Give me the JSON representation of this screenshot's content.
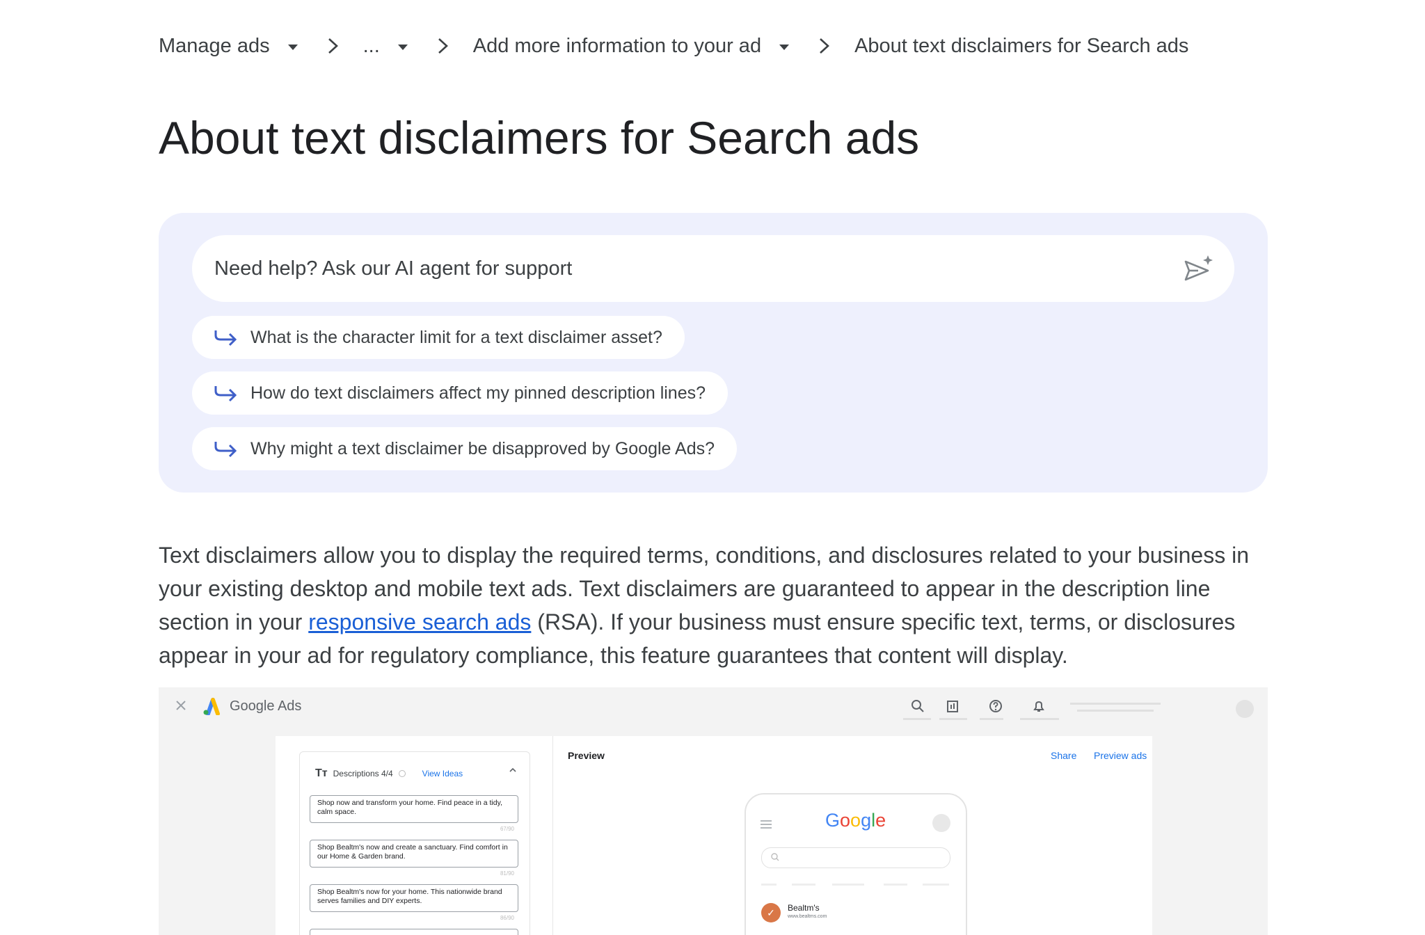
{
  "breadcrumb": {
    "items": [
      {
        "label": "Manage ads",
        "dropdown": true
      },
      {
        "label": "...",
        "dropdown": true
      },
      {
        "label": "Add more information to your ad",
        "dropdown": true
      },
      {
        "label": "About text disclaimers for Search ads",
        "dropdown": false
      }
    ]
  },
  "page_title": "About text disclaimers for Search ads",
  "ai_support": {
    "placeholder": "Need help? Ask our AI agent for support",
    "suggestions": [
      "What is the character limit for a text disclaimer asset?",
      "How do text disclaimers affect my pinned description lines?",
      "Why might a text disclaimer be disapproved by Google Ads?"
    ]
  },
  "body": {
    "part1": "Text disclaimers allow you to display the required terms, conditions, and disclosures related to your business in your existing desktop and mobile text ads. Text disclaimers are guaranteed to appear in the description line section in your ",
    "link": "responsive search ads",
    "part2": " (RSA). If your business must ensure specific text, terms, or disclosures appear in your ad for regulatory compliance, this feature guarantees that content will display."
  },
  "screenshot": {
    "app_name": "Google Ads",
    "descriptions_header": "Descriptions 4/4",
    "view_ideas": "View Ideas",
    "descriptions": [
      {
        "text": "Shop now and transform your home. Find peace in a tidy, calm space.",
        "count": "67/90"
      },
      {
        "text": "Shop Bealtm's now and create a sanctuary. Find comfort in our Home & Garden brand.",
        "count": "81/90"
      },
      {
        "text": "Shop Bealtm's now for your home. This nationwide brand serves families and DIY experts.",
        "count": "86/90"
      }
    ],
    "preview_label": "Preview",
    "share_label": "Share",
    "preview_ads_label": "Preview ads",
    "google_logo": "Google",
    "business_name": "Bealtm's",
    "business_url": "www.bealtms.com",
    "colors": {
      "google_blue": "#4285F4",
      "google_red": "#EA4335",
      "google_yellow": "#FBBC05",
      "google_green": "#34A853"
    }
  },
  "colors": {
    "ai_panel_bg": "#eef0fd",
    "link": "#1a5fd6",
    "suggestion_arrow": "#3f5fc8"
  }
}
